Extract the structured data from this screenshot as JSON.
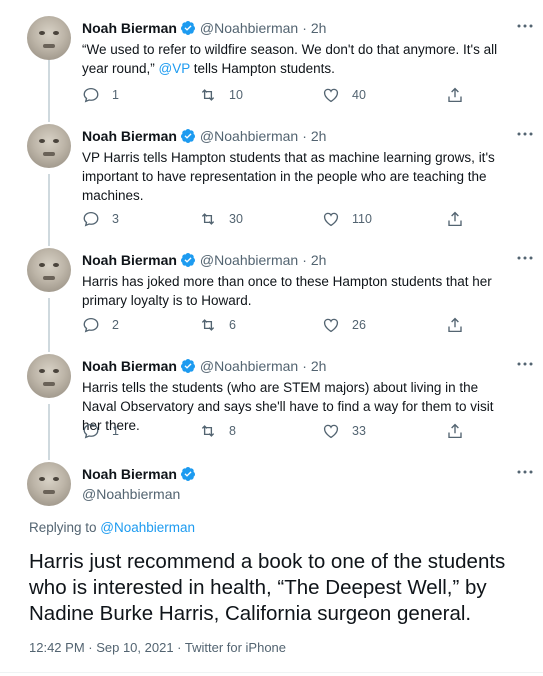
{
  "thread": [
    {
      "name": "Noah Bierman",
      "handle": "@Noahbierman",
      "separator": "·",
      "time": "2h",
      "text_before": "“We used to refer to wildfire season. We don't do that anymore. It's all year round,” ",
      "mention": "@VP",
      "text_after": " tells Hampton students.",
      "replies": "1",
      "retweets": "10",
      "likes": "40"
    },
    {
      "name": "Noah Bierman",
      "handle": "@Noahbierman",
      "separator": "·",
      "time": "2h",
      "text": "VP Harris tells Hampton students that as machine learning grows, it's important to have representation in the people who are teaching the machines.",
      "replies": "3",
      "retweets": "30",
      "likes": "110"
    },
    {
      "name": "Noah Bierman",
      "handle": "@Noahbierman",
      "separator": "·",
      "time": "2h",
      "text": "Harris has joked more than once to these Hampton students that her primary loyalty is to Howard.",
      "replies": "2",
      "retweets": "6",
      "likes": "26"
    },
    {
      "name": "Noah Bierman",
      "handle": "@Noahbierman",
      "separator": "·",
      "time": "2h",
      "text": "Harris tells the students (who are STEM majors) about living in the Naval Observatory and says she'll have to find a way for them to visit her there.",
      "replies": "1",
      "retweets": "8",
      "likes": "33"
    }
  ],
  "main_tweet": {
    "name": "Noah Bierman",
    "handle": "@Noahbierman",
    "replying_label": "Replying to ",
    "replying_to": "@Noahbierman",
    "text": "Harris just recommend a book to one of the students who is interested in health, “The Deepest Well,” by Nadine Burke Harris, California surgeon general.",
    "timestamp": "12:42 PM · Sep 10, 2021 · Twitter for iPhone"
  },
  "colors": {
    "accent": "#1d9bf0",
    "secondary_text": "#536471",
    "thread_line": "#cfd9de"
  },
  "icons": [
    "verified-badge-icon",
    "more-icon",
    "reply-icon",
    "retweet-icon",
    "like-icon",
    "share-icon"
  ]
}
